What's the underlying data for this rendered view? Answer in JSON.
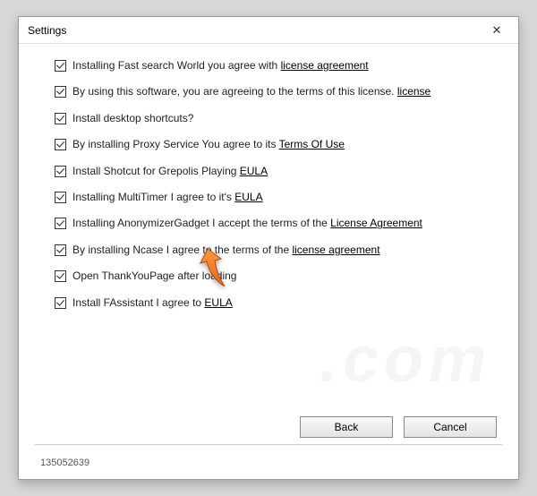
{
  "window": {
    "title": "Settings",
    "close_glyph": "✕"
  },
  "options": [
    {
      "text_before": "Installing Fast search World you agree with  ",
      "link": "license agreement",
      "text_after": ""
    },
    {
      "text_before": "By using this software, you are agreeing to the terms of this license. ",
      "link": "license",
      "text_after": ""
    },
    {
      "text_before": "Install desktop shortcuts?",
      "link": "",
      "text_after": ""
    },
    {
      "text_before": "By installing Proxy Service You agree to its  ",
      "link": "Terms Of Use",
      "text_after": ""
    },
    {
      "text_before": "Install Shotcut for Grepolis Playing   ",
      "link": "EULA",
      "text_after": ""
    },
    {
      "text_before": "Installing MultiTimer I agree to it's  ",
      "link": "EULA",
      "text_after": ""
    },
    {
      "text_before": "Installing AnonymizerGadget I accept the terms of the  ",
      "link": "License Agreement",
      "text_after": ""
    },
    {
      "text_before": "By installing Ncase I agree to the terms of the  ",
      "link": "license agreement",
      "text_after": ""
    },
    {
      "text_before": "Open ThankYouPage after loading",
      "link": "",
      "text_after": ""
    },
    {
      "text_before": "Install FAssistant I agree to  ",
      "link": "EULA",
      "text_after": ""
    }
  ],
  "buttons": {
    "back": "Back",
    "cancel": "Cancel"
  },
  "footer_id": "135052639",
  "watermark": ".com"
}
